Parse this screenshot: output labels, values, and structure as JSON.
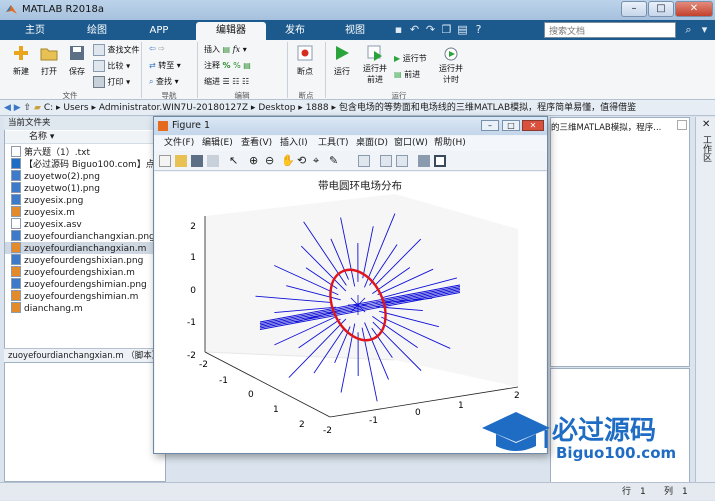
{
  "window": {
    "title": "MATLAB R2018a",
    "min": "–",
    "max": "□",
    "close": "✕"
  },
  "tabs": [
    "主页",
    "绘图",
    "APP",
    "编辑器",
    "发布",
    "视图"
  ],
  "search": {
    "placeholder": "搜索文档"
  },
  "ribbon": {
    "new": "新建",
    "open": "打开",
    "save": "保存",
    "find_files": "查找文件",
    "compare": "比较",
    "print": "打印",
    "goto": "转至",
    "find": "查找",
    "insert": "插入",
    "comment": "注释",
    "indent": "缩进",
    "breakpoints": "断点",
    "run": "运行",
    "run_advance_1": "运行并",
    "run_advance_2": "前进",
    "run_section": "运行节",
    "advance": "前进",
    "run_time_1": "运行并",
    "run_time_2": "计时",
    "groups": {
      "file": "文件",
      "navigate": "导航",
      "edit": "编辑",
      "breakpoints": "断点",
      "run": "运行"
    }
  },
  "address": {
    "path": [
      "C:",
      "Users",
      "Administrator.WIN7U-20180127Z",
      "Desktop",
      "1888",
      "包含电场的等势面和电场线的三维MATLAB模拟，程序简单易懂，值得借鉴"
    ]
  },
  "current_folder": {
    "header": "当前文件夹",
    "column": "名称",
    "files": [
      {
        "name": "第六题（1）.txt",
        "icon": "text-file-icon"
      },
      {
        "name": "【必过源码 Biguo100.com】点",
        "icon": "graduation-cap-icon"
      },
      {
        "name": "zuoyetwo(2).png",
        "icon": "image-file-icon"
      },
      {
        "name": "zuoyetwo(1).png",
        "icon": "image-file-icon"
      },
      {
        "name": "zuoyesix.png",
        "icon": "image-file-icon"
      },
      {
        "name": "zuoyesix.m",
        "icon": "m-file-icon"
      },
      {
        "name": "zuoyesix.asv",
        "icon": "text-file-icon"
      },
      {
        "name": "zuoyefourdianchangxian.png",
        "icon": "image-file-icon"
      },
      {
        "name": "zuoyefourdianchangxian.m",
        "icon": "m-file-icon",
        "selected": true
      },
      {
        "name": "zuoyefourdengshixian.png",
        "icon": "image-file-icon"
      },
      {
        "name": "zuoyefourdengshixian.m",
        "icon": "m-file-icon"
      },
      {
        "name": "zuoyefourdengshimian.png",
        "icon": "image-file-icon"
      },
      {
        "name": "zuoyefourdengshimian.m",
        "icon": "m-file-icon"
      },
      {
        "name": "dianchang.m",
        "icon": "m-file-icon"
      }
    ]
  },
  "details": {
    "label": "zuoyefourdianchangxian.m （脚本）"
  },
  "right_panel": {
    "path_text": "的三维MATLAB模拟，程序...",
    "side_label": "工作区"
  },
  "figure": {
    "title": "Figure 1",
    "menu": [
      "文件(F)",
      "编辑(E)",
      "查看(V)",
      "插入(I)",
      "工具(T)",
      "桌面(D)",
      "窗口(W)",
      "帮助(H)"
    ],
    "plot_title": "带电圆环电场分布",
    "z_ticks": [
      "2",
      "1",
      "0",
      "-1",
      "-2"
    ],
    "y_ticks": [
      "-2",
      "-1",
      "0",
      "1",
      "2"
    ],
    "x_ticks": [
      "2",
      "1",
      "0",
      "-1",
      "-2"
    ]
  },
  "status": {
    "row_label": "行",
    "row": "1",
    "col_label": "列",
    "col": "1"
  },
  "watermark": {
    "brand": "必过源码",
    "url": "Biguo100.com"
  },
  "colors": {
    "ring": "#e0141c",
    "field_lines": "#1010d8",
    "tab_bar": "#1c5a8e"
  }
}
